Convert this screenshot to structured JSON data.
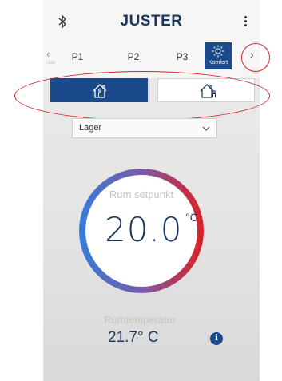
{
  "app": {
    "title": "JUSTER"
  },
  "icons": {
    "bluetooth": "bluetooth-icon",
    "menu": "more-vertical-icon",
    "sun": "sun-icon",
    "home_active": "house-person-icon",
    "home_away": "house-away-icon",
    "info": "info-icon"
  },
  "tabs": {
    "left_arrow": "‹",
    "left_small": "Ude",
    "items": [
      "P1",
      "P2",
      "P3"
    ],
    "komfort_label": "Komfort",
    "right_arrow": "›"
  },
  "mode_select": {
    "value": "Lager"
  },
  "setpoint": {
    "label": "Rum setpunkt",
    "value": "20.0",
    "unit": "°C"
  },
  "room": {
    "label": "Rumtemperatur",
    "value": "21.7° C"
  },
  "colors": {
    "brand": "#1b365d",
    "accent": "#1b4a8c",
    "highlight": "#d8232a",
    "dial_cold": "#3a7bd5",
    "dial_hot": "#d8232a"
  }
}
